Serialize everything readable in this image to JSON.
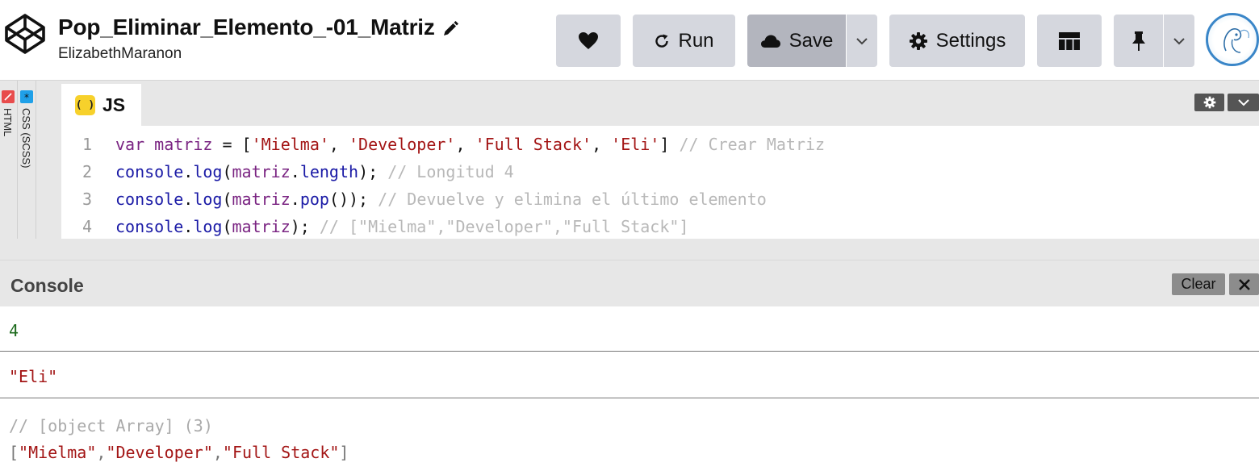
{
  "header": {
    "title": "Pop_Eliminar_Elemento_-01_Matriz",
    "author": "ElizabethMaranon",
    "buttons": {
      "run": "Run",
      "save": "Save",
      "settings": "Settings"
    }
  },
  "sidebar": {
    "html_label": "HTML",
    "css_label": "CSS (SCSS)"
  },
  "editor": {
    "tab_label": "JS",
    "tab_icon_text": "( )",
    "lines": [
      {
        "number": "1",
        "tokens": [
          "var",
          " ",
          "matriz",
          " = [",
          "'Mielma'",
          ", ",
          "'Developer'",
          ", ",
          "'Full Stack'",
          ", ",
          "'Eli'",
          "] ",
          "// Crear Matriz"
        ]
      },
      {
        "number": "2",
        "tokens": [
          "console",
          ".",
          "log",
          "(",
          "matriz",
          ".",
          "length",
          "); ",
          "// Longitud 4"
        ]
      },
      {
        "number": "3",
        "tokens": [
          "console",
          ".",
          "log",
          "(",
          "matriz",
          ".",
          "pop",
          "()); ",
          "// Devuelve y elimina el último elemento"
        ]
      },
      {
        "number": "4",
        "tokens": [
          "console",
          ".",
          "log",
          "(",
          "matriz",
          "); ",
          "// [\"Mielma\",\"Developer\",\"Full Stack\"]"
        ]
      }
    ]
  },
  "console": {
    "title": "Console",
    "clear_label": "Clear",
    "outputs": {
      "first": "4",
      "second": "\"Eli\"",
      "third_comment": "// [object Array] (3)",
      "third_value": {
        "open": "[",
        "items": [
          "\"Mielma\"",
          "\"Developer\"",
          "\"Full Stack\""
        ],
        "sep": ",",
        "close": "]"
      }
    }
  },
  "colors": {
    "accent_save": "#b3b5be",
    "button_bg": "#d5d7de",
    "js_icon": "#f7d12b",
    "html_badge": "#e84c4c",
    "css_badge": "#1fa0e8",
    "string": "#a31515",
    "number": "#1e6b1e",
    "comment": "#b8b8b8"
  },
  "icons": {
    "logo": "codepen-logo-icon",
    "edit": "pencil-icon",
    "like": "heart-icon",
    "run": "refresh-icon",
    "save": "cloud-icon",
    "settings": "gear-icon",
    "layout": "layout-grid-icon",
    "pin": "pin-icon",
    "dropdown": "chevron-down-icon",
    "close": "close-icon"
  }
}
